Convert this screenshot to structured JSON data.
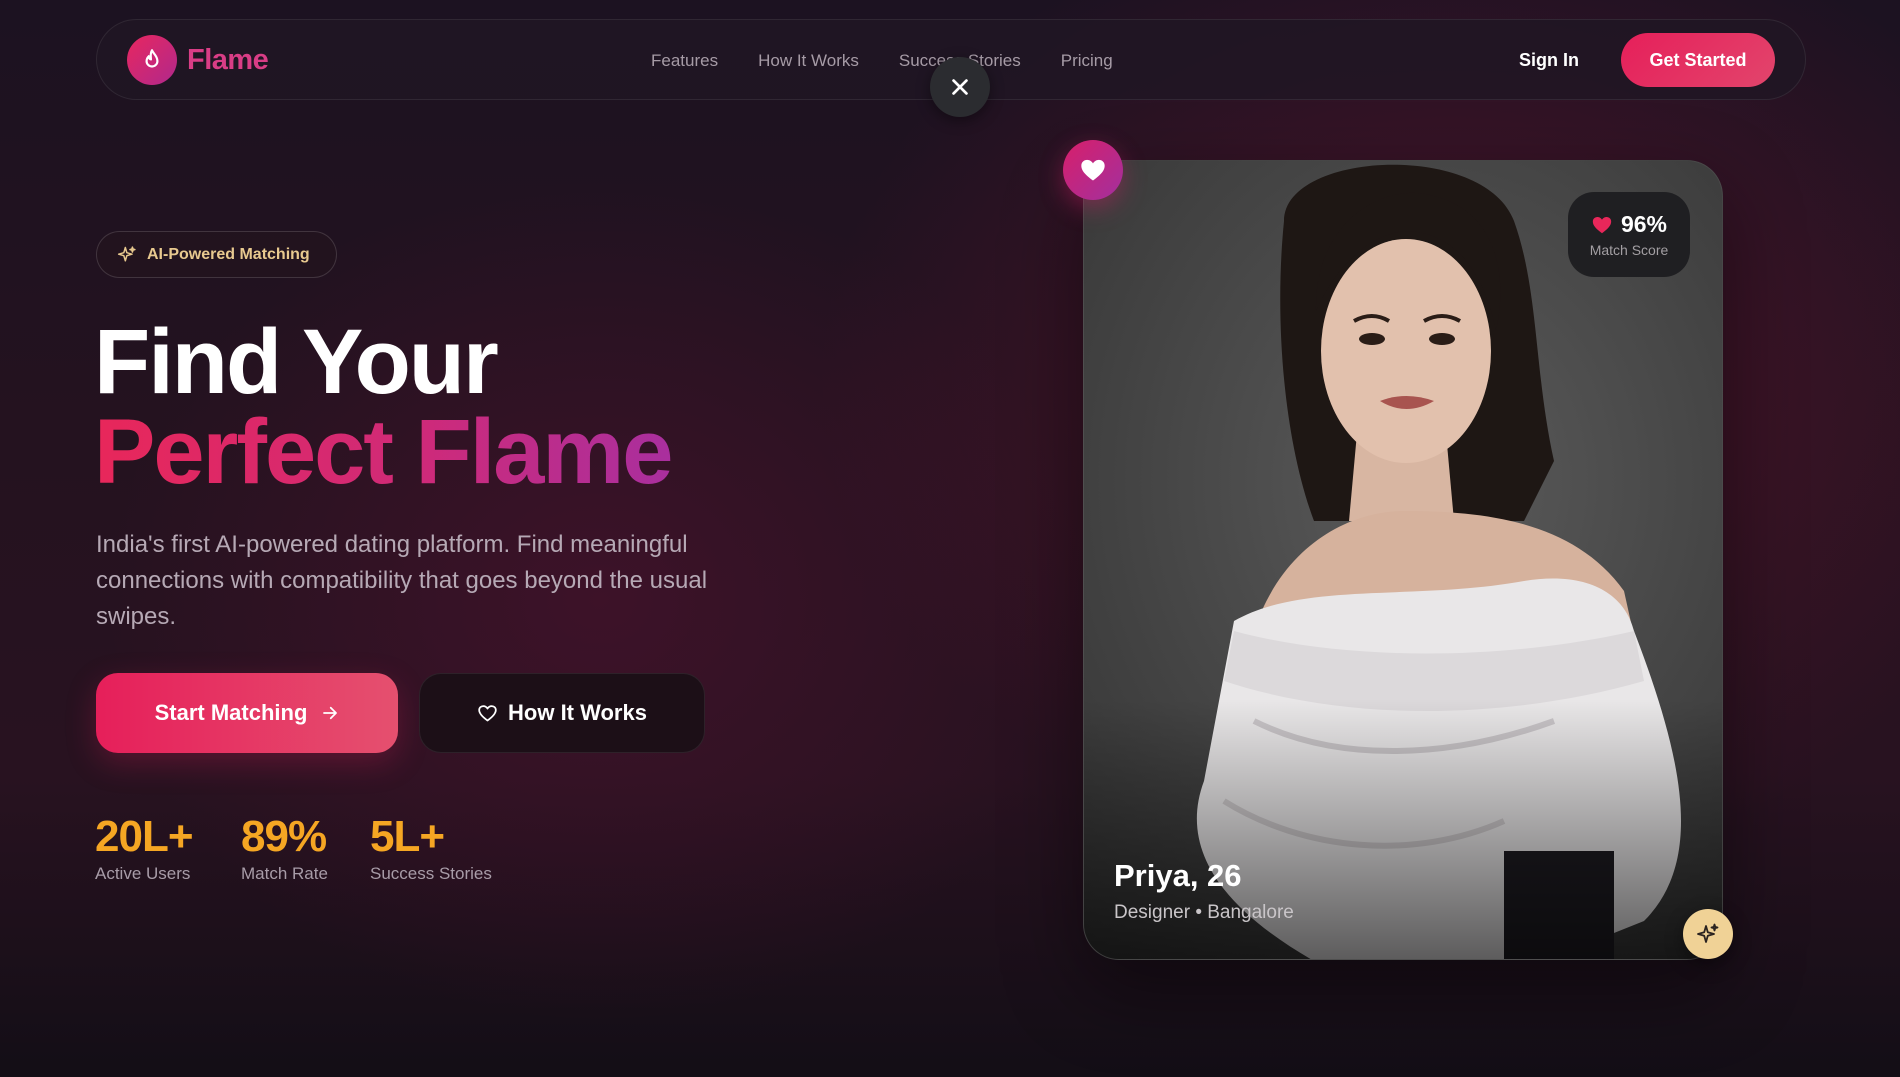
{
  "nav": {
    "brand": "Flame",
    "links": [
      "Features",
      "How It Works",
      "Success Stories",
      "Pricing"
    ],
    "sign_in": "Sign In",
    "get_started": "Get Started"
  },
  "hero": {
    "badge": "AI-Powered Matching",
    "title_line1": "Find Your",
    "title_line2": "Perfect Flame",
    "subtitle": "India's first AI-powered dating platform. Find meaningful connections with compatibility that goes beyond the usual swipes.",
    "primary_cta": "Start Matching",
    "secondary_cta": "How It Works",
    "stats": [
      {
        "value": "20L+",
        "label": "Active Users"
      },
      {
        "value": "89%",
        "label": "Match Rate"
      },
      {
        "value": "5L+",
        "label": "Success Stories"
      }
    ]
  },
  "profile_card": {
    "match_value": "96%",
    "match_label": "Match Score",
    "name": "Priya, 26",
    "meta": "Designer • Bangalore"
  },
  "icons": {
    "logo": "flame-icon",
    "badge": "sparkles-icon",
    "primary_cta": "arrow-right-icon",
    "secondary_cta": "heart-outline-icon",
    "match": "heart-icon",
    "close": "close-icon"
  },
  "colors": {
    "accent": "#e61f5a",
    "magenta": "#a92f9e",
    "stat": "#f5a623",
    "sparkle_badge": "#f0d296"
  }
}
